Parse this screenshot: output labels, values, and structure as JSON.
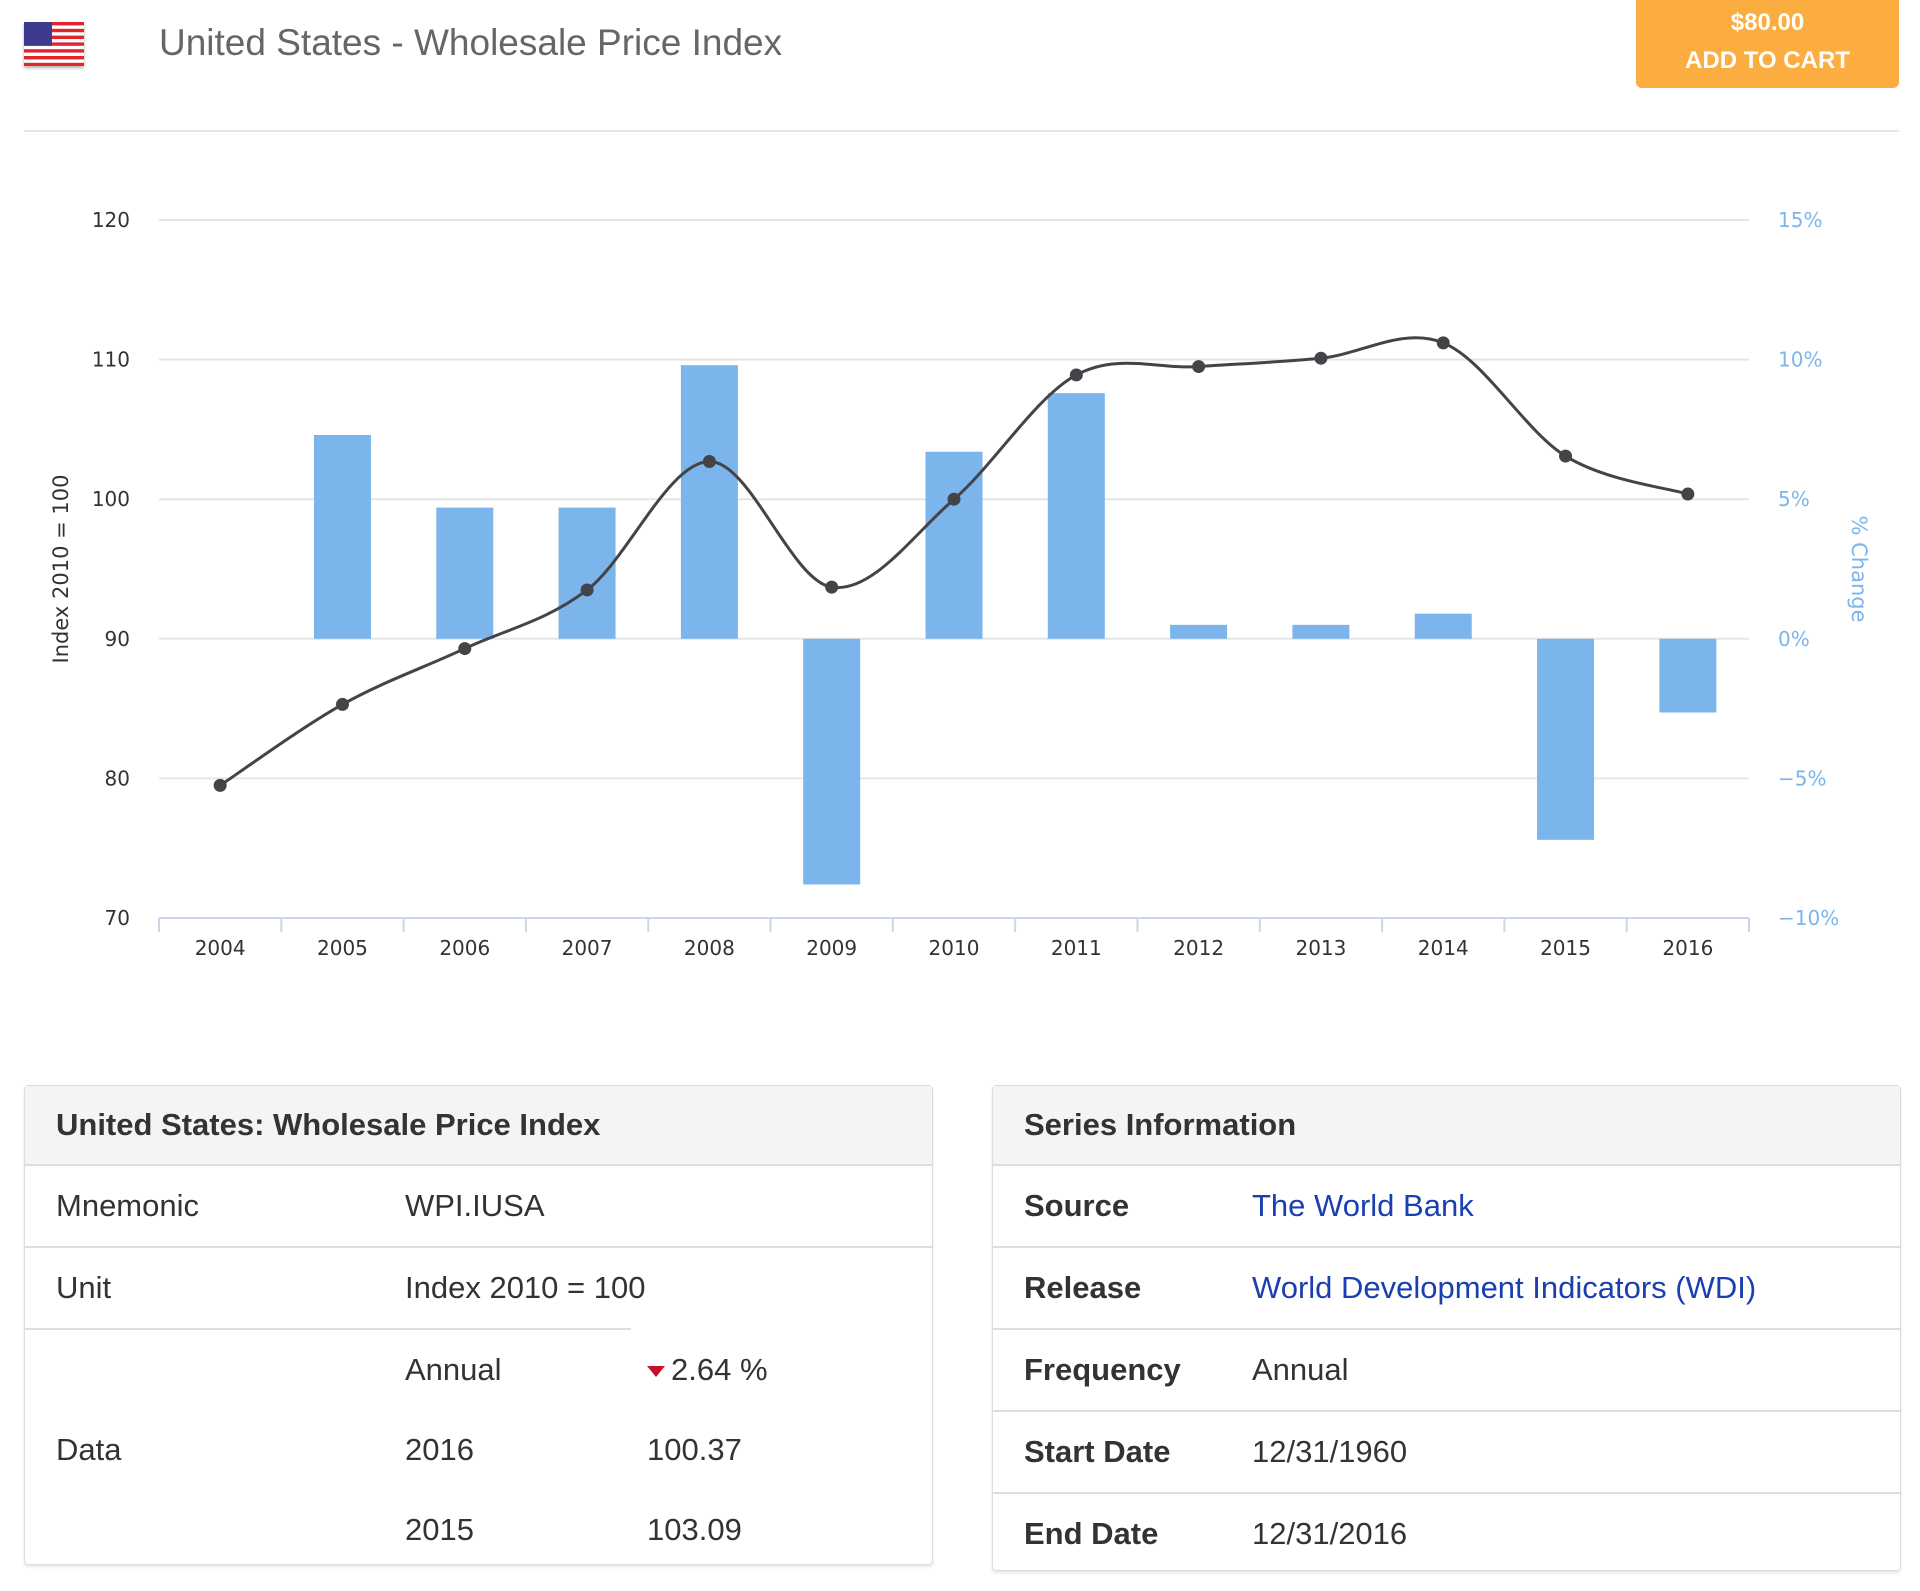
{
  "header": {
    "title": "United States - Wholesale Price Index",
    "flag_icon": "us-flag-icon",
    "price": "$80.00",
    "cart_label": "ADD TO CART",
    "cart_color": "#fbad3f"
  },
  "chart_data": {
    "type": "bar+line",
    "categories": [
      "2004",
      "2005",
      "2006",
      "2007",
      "2008",
      "2009",
      "2010",
      "2011",
      "2012",
      "2013",
      "2014",
      "2015",
      "2016"
    ],
    "series": [
      {
        "type": "line",
        "axis": "left",
        "color": "#434348",
        "values": [
          79.5,
          85.3,
          89.3,
          93.5,
          102.7,
          93.7,
          100.0,
          108.9,
          109.5,
          110.1,
          111.2,
          103.09,
          100.37
        ]
      },
      {
        "type": "bar",
        "axis": "right",
        "color": "#7cb5ec",
        "values": [
          null,
          7.3,
          4.7,
          4.7,
          9.8,
          -8.8,
          6.7,
          8.8,
          0.5,
          0.5,
          0.9,
          -7.2,
          -2.64
        ]
      }
    ],
    "ylabel": "Index 2010 = 100",
    "ylabel_right": "% Change",
    "ylim": [
      70,
      120
    ],
    "yticks": [
      "70",
      "80",
      "90",
      "100",
      "110",
      "120"
    ],
    "ylim_right": [
      -10,
      15
    ],
    "yticks_right": [
      "−10%",
      "−5%",
      "0%",
      "5%",
      "10%",
      "15%"
    ],
    "grid": true
  },
  "left_panel": {
    "title": "United States: Wholesale Price Index",
    "mnemonic_label": "Mnemonic",
    "mnemonic": "WPI.IUSA",
    "unit_label": "Unit",
    "unit": "Index 2010 = 100",
    "data_label": "Data",
    "annual_label": "Annual",
    "annual_change": "2.64 %",
    "change_direction": "down",
    "rows": [
      {
        "year": "2016",
        "value": "100.37"
      },
      {
        "year": "2015",
        "value": "103.09"
      }
    ]
  },
  "right_panel": {
    "title": "Series Information",
    "rows": [
      {
        "label": "Source",
        "value": "The World Bank",
        "link": true
      },
      {
        "label": "Release",
        "value": "World Development Indicators (WDI)",
        "link": true
      },
      {
        "label": "Frequency",
        "value": "Annual"
      },
      {
        "label": "Start Date",
        "value": "12/31/1960"
      },
      {
        "label": "End Date",
        "value": "12/31/2016"
      }
    ]
  }
}
